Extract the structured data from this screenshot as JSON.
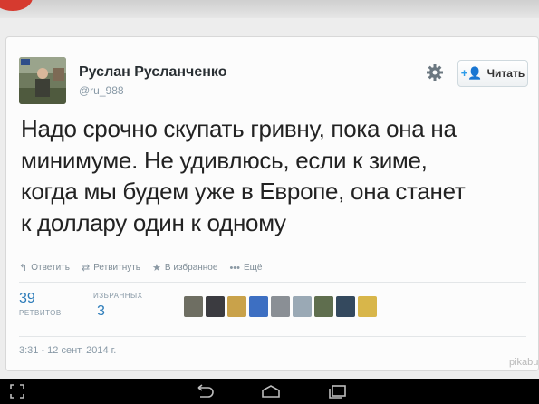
{
  "colors": {
    "link": "#2b7bb9",
    "follow_icon": "#2b9be9",
    "muted": "#8899a6",
    "status_bar_red": "#d63a2f"
  },
  "user": {
    "name": "Руслан Русланченко",
    "handle": "@ru_988",
    "avatar_icon": "avatar-photo-icon"
  },
  "header": {
    "settings_icon": "gear-icon",
    "follow_label": "Читать",
    "follow_icon": "add-user-icon"
  },
  "tweet": {
    "lines": [
      "Надо срочно скупать гривну, пока она на",
      "минимуме. Не удивлюсь, если к зиме,",
      "когда мы будем уже в Европе, она станет",
      "к доллару один к одному"
    ]
  },
  "actions": [
    {
      "icon": "reply-icon",
      "glyph": "↰",
      "label": "Ответить"
    },
    {
      "icon": "retweet-icon",
      "glyph": "⇄",
      "label": "Ретвитнуть"
    },
    {
      "icon": "star-icon",
      "glyph": "★",
      "label": "В избранное"
    },
    {
      "icon": "more-icon",
      "glyph": "•••",
      "label": "Ещё"
    }
  ],
  "stats": {
    "retweets_count": "39",
    "retweets_label": "РЕТВИТОВ",
    "favorites_count": "3",
    "favorites_label": "ИЗБРАННЫХ"
  },
  "favoriters": [
    {
      "color": "#6e6e62"
    },
    {
      "color": "#3b3b40"
    },
    {
      "color": "#c9a24a"
    },
    {
      "color": "#3d6fc2"
    },
    {
      "color": "#8a8f95"
    },
    {
      "color": "#9aa9b5"
    },
    {
      "color": "#5f6e4e"
    },
    {
      "color": "#34495e"
    },
    {
      "color": "#d8b64a"
    }
  ],
  "timestamp": "3:31 - 12 сент. 2014 г.",
  "watermark": "pikabu",
  "navbar": {
    "icons": [
      "screenshot-icon",
      "back-icon",
      "home-icon",
      "recent-apps-icon"
    ]
  }
}
